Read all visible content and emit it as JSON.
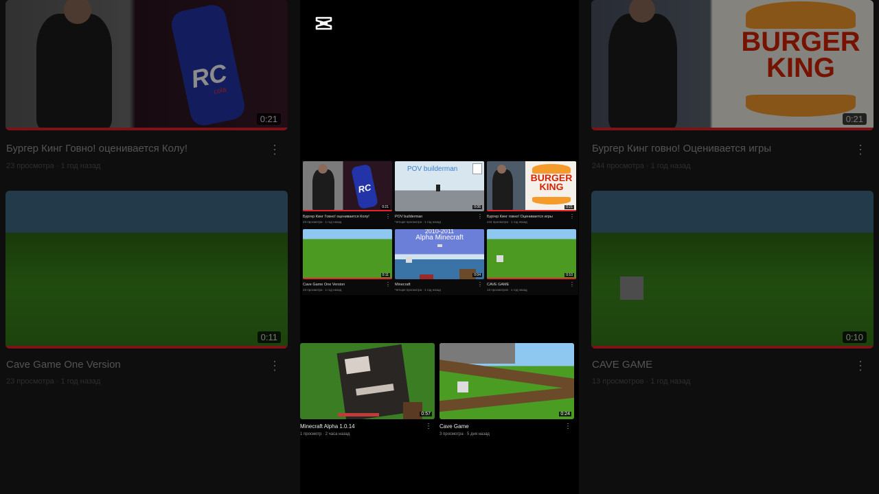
{
  "background": {
    "left_top": {
      "title": "Бургер Кинг Говно! оценивается Колу!",
      "meta": "23 просмотра · 1 год назад",
      "duration": "0:21"
    },
    "left_bottom": {
      "title": "Cave Game One Version",
      "meta": "23 просмотра · 1 год назад",
      "duration": "0:11"
    },
    "right_top": {
      "title": "Бургер Кинг говно! Оценивается игры",
      "meta": "244 просмотра · 1 год назад",
      "duration": "0:21",
      "logo_line1": "BURGER",
      "logo_line2": "KING"
    },
    "right_bottom": {
      "title": "CAVE GAME",
      "meta": "13 просмотров · 1 год назад",
      "duration": "0:10"
    },
    "rc_logo": "RC",
    "rc_sub": "cola"
  },
  "grid": [
    {
      "title": "Бургер Кинг Говно! оценивается Колу!",
      "meta": "23 просмотра · 1 год назад",
      "duration": "0:21",
      "thumb_text": "RC"
    },
    {
      "title": "POV builderman",
      "meta": "Четыре просмотра · 1 год назад",
      "duration": "0:06",
      "thumb_text": "POV builderman"
    },
    {
      "title": "Бургер Кинг говно! Оценивается игры",
      "meta": "244 просмотра · 1 год назад",
      "duration": "0:21",
      "logo_line1": "BURGER",
      "logo_line2": "KING"
    },
    {
      "title": "Cave Game One Version",
      "meta": "23 просмотра · 1 год назад",
      "duration": "0:11"
    },
    {
      "title": "Minecraft",
      "meta": "Четыре просмотра · 1 год назад",
      "duration": "0:04",
      "thumb_line1": "2010-2011",
      "thumb_line2": "Alpha Minecraft"
    },
    {
      "title": "CAVE GAME",
      "meta": "13 просмотров · 1 год назад",
      "duration": "0:10"
    }
  ],
  "bottom": [
    {
      "title": "Minecraft Alpha 1.0.14",
      "meta": "1 просмотр · 2 часа назад",
      "duration": "0:57"
    },
    {
      "title": "Cave Game",
      "meta": "3 просмотра · 5 дня назад",
      "duration": "0:24"
    }
  ],
  "colors": {
    "accent_red": "#e6232a",
    "grass": "#3c8a1c",
    "sky": "#8fc6ee"
  }
}
